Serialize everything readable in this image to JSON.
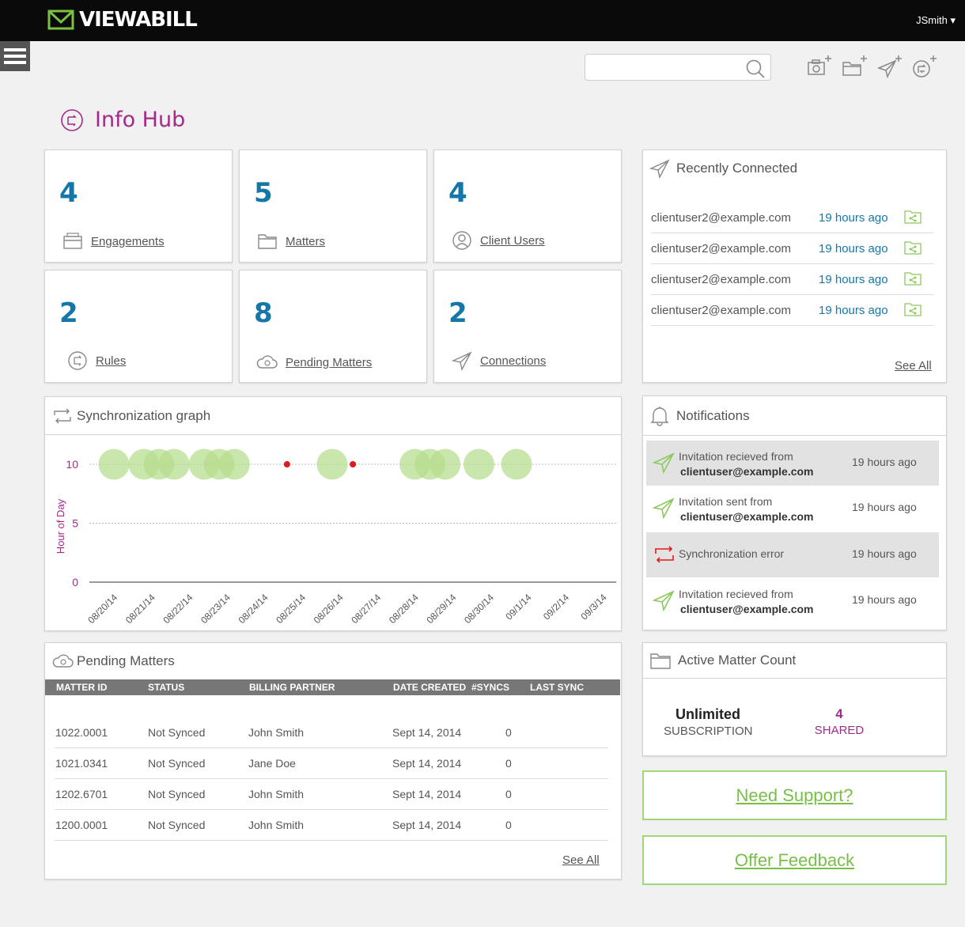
{
  "app": {
    "logo_text": "VIEWABILL",
    "user_menu": "JSmith ▾"
  },
  "search": {
    "placeholder": "",
    "value": ""
  },
  "page": {
    "title": "Info Hub"
  },
  "stats": [
    {
      "value": "4",
      "label": "Engagements",
      "icon": "inbox-icon"
    },
    {
      "value": "5",
      "label": "Matters",
      "icon": "folder-icon"
    },
    {
      "value": "4",
      "label": "Client Users",
      "icon": "user-circle-icon"
    },
    {
      "value": "2",
      "label": "Rules",
      "icon": "rule-icon"
    },
    {
      "value": "8",
      "label": "Pending Matters",
      "icon": "cloud-sync-icon"
    },
    {
      "value": "2",
      "label": "Connections",
      "icon": "paper-plane-icon"
    }
  ],
  "recently_connected": {
    "title": "Recently Connected",
    "rows": [
      {
        "email": "clientuser2@example.com",
        "time": "19 hours ago"
      },
      {
        "email": "clientuser2@example.com",
        "time": "19 hours ago"
      },
      {
        "email": "clientuser2@example.com",
        "time": "19 hours ago"
      },
      {
        "email": "clientuser2@example.com",
        "time": "19 hours ago"
      }
    ],
    "see_all": "See All"
  },
  "sync_graph": {
    "title": "Synchronization graph"
  },
  "chart_data": {
    "type": "scatter",
    "title": "",
    "xlabel": "",
    "ylabel": "Hour of Day",
    "ylim": [
      0,
      10
    ],
    "yticks": [
      "0",
      "5",
      "10"
    ],
    "x_categories": [
      "08/20/14",
      "08/21/14",
      "08/22/14",
      "08/23/14",
      "08/24/14",
      "08/25/14",
      "08/26/14",
      "08/27/14",
      "08/28/14",
      "08/29/14",
      "08/30/14",
      "09/1/14",
      "09/2/14",
      "09/3/14"
    ],
    "grid": true,
    "series": [
      {
        "color": "#b4dc8c",
        "points": [
          {
            "x": 0.4,
            "y": 10
          },
          {
            "x": 1.2,
            "y": 10
          },
          {
            "x": 1.6,
            "y": 10
          },
          {
            "x": 2.0,
            "y": 10
          },
          {
            "x": 2.8,
            "y": 10
          },
          {
            "x": 3.2,
            "y": 10
          },
          {
            "x": 3.6,
            "y": 10
          },
          {
            "x": 6.2,
            "y": 10
          },
          {
            "x": 8.4,
            "y": 10
          },
          {
            "x": 8.8,
            "y": 10
          },
          {
            "x": 9.2,
            "y": 10
          },
          {
            "x": 10.1,
            "y": 10
          },
          {
            "x": 11.1,
            "y": 10
          }
        ]
      },
      {
        "color": "#e01b1b",
        "points": [
          {
            "x": 5.0,
            "y": 10
          },
          {
            "x": 6.75,
            "y": 10
          }
        ]
      }
    ]
  },
  "notifications": {
    "title": "Notifications",
    "items": [
      {
        "line1": "Invitation recieved from",
        "line2": "clientuser@example.com",
        "time": "19 hours ago",
        "icon": "paper-plane-icon"
      },
      {
        "line1": "Invitation sent from",
        "line2": "clientuser@example.com",
        "time": "19 hours ago",
        "icon": "paper-plane-icon"
      },
      {
        "line1": "Synchronization error",
        "line2": "",
        "time": "19 hours ago",
        "icon": "sync-error-icon"
      },
      {
        "line1": "Invitation recieved from",
        "line2": "clientuser@example.com",
        "time": "19 hours ago",
        "icon": "paper-plane-icon"
      }
    ]
  },
  "pending_matters": {
    "title": "Pending Matters",
    "columns": [
      "MATTER ID",
      "STATUS",
      "BILLING PARTNER",
      "DATE CREATED",
      "#SYNCS",
      "LAST SYNC"
    ],
    "rows": [
      [
        "1022.0001",
        "Not Synced",
        "John Smith",
        "Sept 14, 2014",
        "0",
        ""
      ],
      [
        "1021.0341",
        "Not Synced",
        "Jane Doe",
        "Sept 14, 2014",
        "0",
        ""
      ],
      [
        "1202.6701",
        "Not Synced",
        "John Smith",
        "Sept 14, 2014",
        "0",
        ""
      ],
      [
        "1200.0001",
        "Not Synced",
        "John Smith",
        "Sept 14, 2014",
        "0",
        ""
      ]
    ],
    "see_all": "See All"
  },
  "active_matter_count": {
    "title": "Active Matter Count",
    "subscription_value": "Unlimited",
    "subscription_label": "SUBSCRIPTION",
    "shared_value": "4",
    "shared_label": "SHARED"
  },
  "links": {
    "support": "Need Support?",
    "feedback": "Offer Feedback"
  },
  "colors": {
    "accent_purple": "#a32b88",
    "accent_blue": "#1577a8",
    "accent_green": "#78bf47",
    "error_red": "#e01b1b"
  }
}
